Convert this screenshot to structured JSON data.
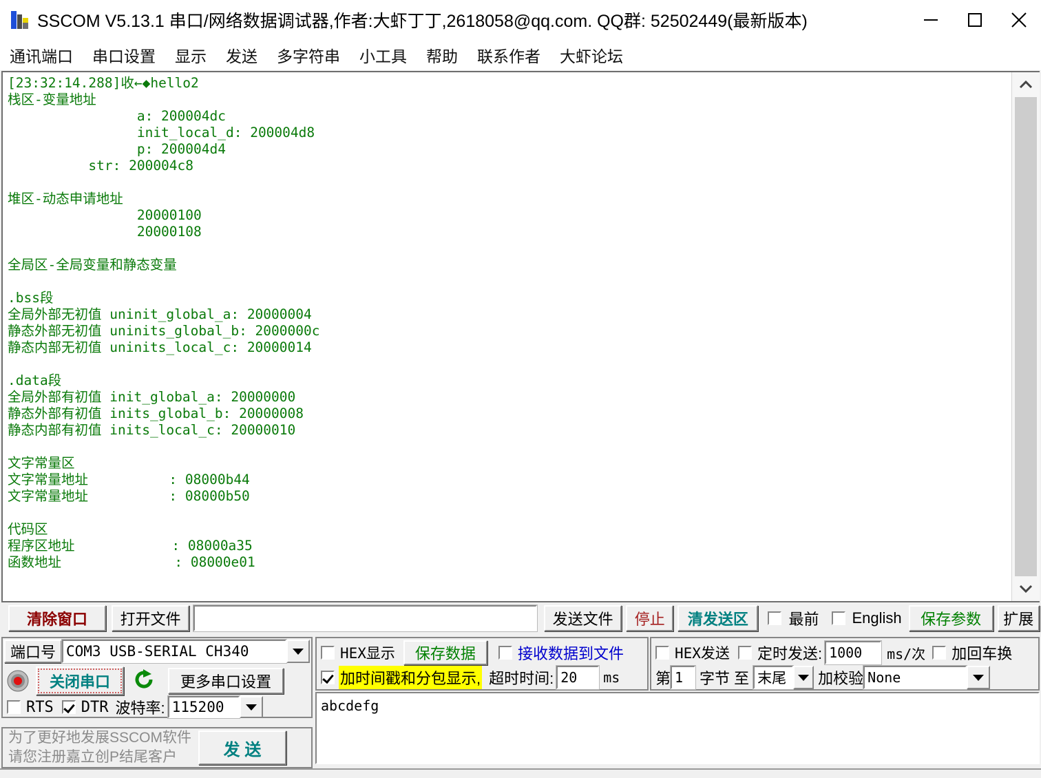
{
  "window": {
    "title": "SSCOM V5.13.1 串口/网络数据调试器,作者:大虾丁丁,2618058@qq.com. QQ群: 52502449(最新版本)",
    "minimize": "minimize-icon",
    "maximize": "maximize-icon",
    "close": "close-icon"
  },
  "menu": {
    "items": [
      {
        "label": "通讯端口"
      },
      {
        "label": "串口设置"
      },
      {
        "label": "显示"
      },
      {
        "label": "发送"
      },
      {
        "label": "多字符串"
      },
      {
        "label": "小工具"
      },
      {
        "label": "帮助"
      },
      {
        "label": "联系作者"
      },
      {
        "label": "大虾论坛"
      }
    ]
  },
  "terminal": {
    "text_color": "#0a7a0a",
    "lines": [
      "[23:32:14.288]收←◆hello2",
      "栈区-变量地址",
      "                a: 200004dc",
      "                init_local_d: 200004d8",
      "                p: 200004d4",
      "          str: 200004c8",
      "",
      "堆区-动态申请地址",
      "                20000100",
      "                20000108",
      "",
      "全局区-全局变量和静态变量",
      "",
      ".bss段",
      "全局外部无初值 uninit_global_a: 20000004",
      "静态外部无初值 uninits_global_b: 2000000c",
      "静态内部无初值 uninits_local_c: 20000014",
      "",
      ".data段",
      "全局外部有初值 init_global_a: 20000000",
      "静态外部有初值 inits_global_b: 20000008",
      "静态内部有初值 inits_local_c: 20000010",
      "",
      "文字常量区",
      "文字常量地址          : 08000b44",
      "文字常量地址          : 08000b50",
      "",
      "代码区",
      "程序区地址            : 08000a35",
      "函数地址              : 08000e01"
    ],
    "scroll_up": "chevron-up-icon",
    "scroll_down": "chevron-down-icon"
  },
  "toolbar": {
    "clear_window": "清除窗口",
    "clear_window_color": "#8b0000",
    "open_file": "打开文件",
    "file_path": "",
    "send_file": "发送文件",
    "stop": "停止",
    "stop_color": "#a52020",
    "clear_send": "清发送区",
    "clear_send_color": "#008080",
    "topmost_label": "最前",
    "topmost_checked": false,
    "english_label": "English",
    "english_checked": false,
    "save_params": "保存参数",
    "save_params_color": "#008000",
    "extend": "扩展"
  },
  "serial": {
    "port_label": "端口号",
    "port_value": "COM3 USB-SERIAL CH340",
    "close_port_button": "关闭串口",
    "close_port_color": "#008080",
    "refresh_icon": "refresh-icon",
    "indicator_icon": "status-led-icon",
    "more_settings": "更多串口设置",
    "rts_label": "RTS",
    "rts_checked": false,
    "dtr_label": "DTR",
    "dtr_checked": true,
    "baud_label": "波特率:",
    "baud_value": "115200"
  },
  "receive_options": {
    "hex_display_label": "HEX显示",
    "hex_display_checked": false,
    "save_data": "保存数据",
    "save_data_color": "#008000",
    "recv_to_file_label": "接收数据到文件",
    "recv_to_file_color": "#0000cd",
    "recv_to_file_checked": false,
    "timestamp_label": "加时间戳和分包显示,",
    "timestamp_checked": true,
    "timestamp_highlight": "#ffff00",
    "timeout_label": "超时时间:",
    "timeout_value": "20",
    "timeout_unit": "ms"
  },
  "send_options": {
    "hex_send_label": "HEX发送",
    "hex_send_checked": false,
    "timed_send_label": "定时发送:",
    "timed_send_checked": false,
    "interval_value": "1000",
    "interval_unit": "ms/次",
    "crlf_label": "加回车换",
    "crlf_checked": false,
    "byte_prefix": "第",
    "byte_index": "1",
    "byte_mid": "字节 至",
    "byte_to": "末尾",
    "checksum_label": "加校验",
    "checksum_value": "None"
  },
  "send_area": {
    "text": "abcdefg"
  },
  "register": {
    "line1": "为了更好地发展SSCOM软件",
    "line2": "请您注册嘉立创P结尾客户",
    "send_button": "发  送",
    "send_button_color": "#008080"
  },
  "statusbar": {
    "text": ""
  }
}
